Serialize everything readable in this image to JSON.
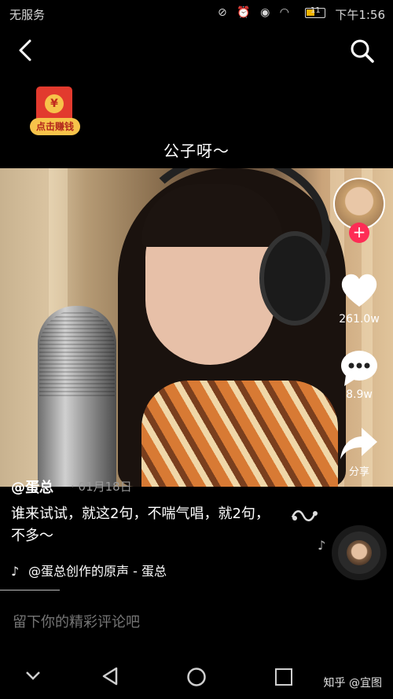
{
  "status_bar": {
    "carrier": "无服务",
    "icons": "⊘ ⏰ ◉ ◠",
    "battery_level": "11",
    "time": "下午1:56"
  },
  "promo": {
    "coin_symbol": "¥",
    "label": "点击赚钱"
  },
  "video": {
    "title": "公子呀～"
  },
  "actions": {
    "like_count": "261.0w",
    "comment_count": "8.9w",
    "share_label": "分享",
    "follow_symbol": "+"
  },
  "post": {
    "author": "@蛋总",
    "date": "· 01月18日",
    "caption": "谁来试试，就这2句，不喘气唱，就2句，不多～",
    "music": "@蛋总创作的原声 - 蛋总"
  },
  "comment": {
    "placeholder": "留下你的精彩评论吧"
  },
  "watermark": "知乎 @宜图",
  "colors": {
    "accent": "#fe2c55",
    "background": "#000000",
    "promo_gold": "#f7c34a",
    "promo_red": "#e23a2e"
  }
}
